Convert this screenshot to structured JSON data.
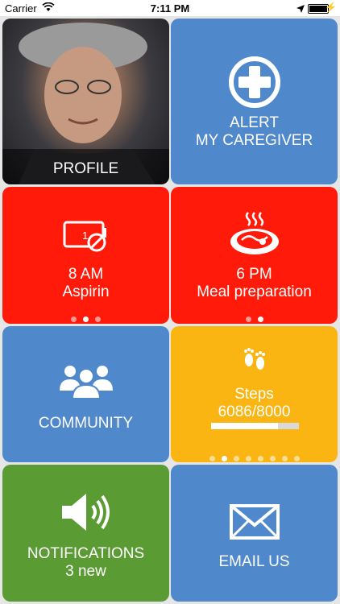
{
  "status_bar": {
    "carrier": "Carrier",
    "time": "7:11 PM"
  },
  "tiles": {
    "profile": {
      "label": "PROFILE"
    },
    "alert": {
      "line1": "ALERT",
      "line2": "MY CAREGIVER"
    },
    "medication": {
      "time": "8 AM",
      "name": "Aspirin",
      "pill_count": "1"
    },
    "meal": {
      "time": "6 PM",
      "name": "Meal preparation"
    },
    "community": {
      "label": "COMMUNITY"
    },
    "steps": {
      "label": "Steps",
      "value": "6086/8000",
      "progress": 0.7608
    },
    "notifications": {
      "label": "NOTIFICATIONS",
      "count": "3 new"
    },
    "email": {
      "label": "EMAIL US"
    }
  },
  "colors": {
    "blue": "#4f89cb",
    "red": "#ff1a0a",
    "yellow": "#fbb512",
    "green": "#5b9b33"
  },
  "icons": {
    "alert": "plus-circle-icon",
    "medication": "pill-box-icon",
    "meal": "hot-dish-icon",
    "community": "people-group-icon",
    "steps": "footprints-icon",
    "notifications": "speaker-icon",
    "email": "envelope-icon"
  },
  "pagers": {
    "medication": {
      "count": 3,
      "active": 1
    },
    "meal": {
      "count": 2,
      "active": 1
    },
    "steps": {
      "count": 8,
      "active": 1
    }
  }
}
